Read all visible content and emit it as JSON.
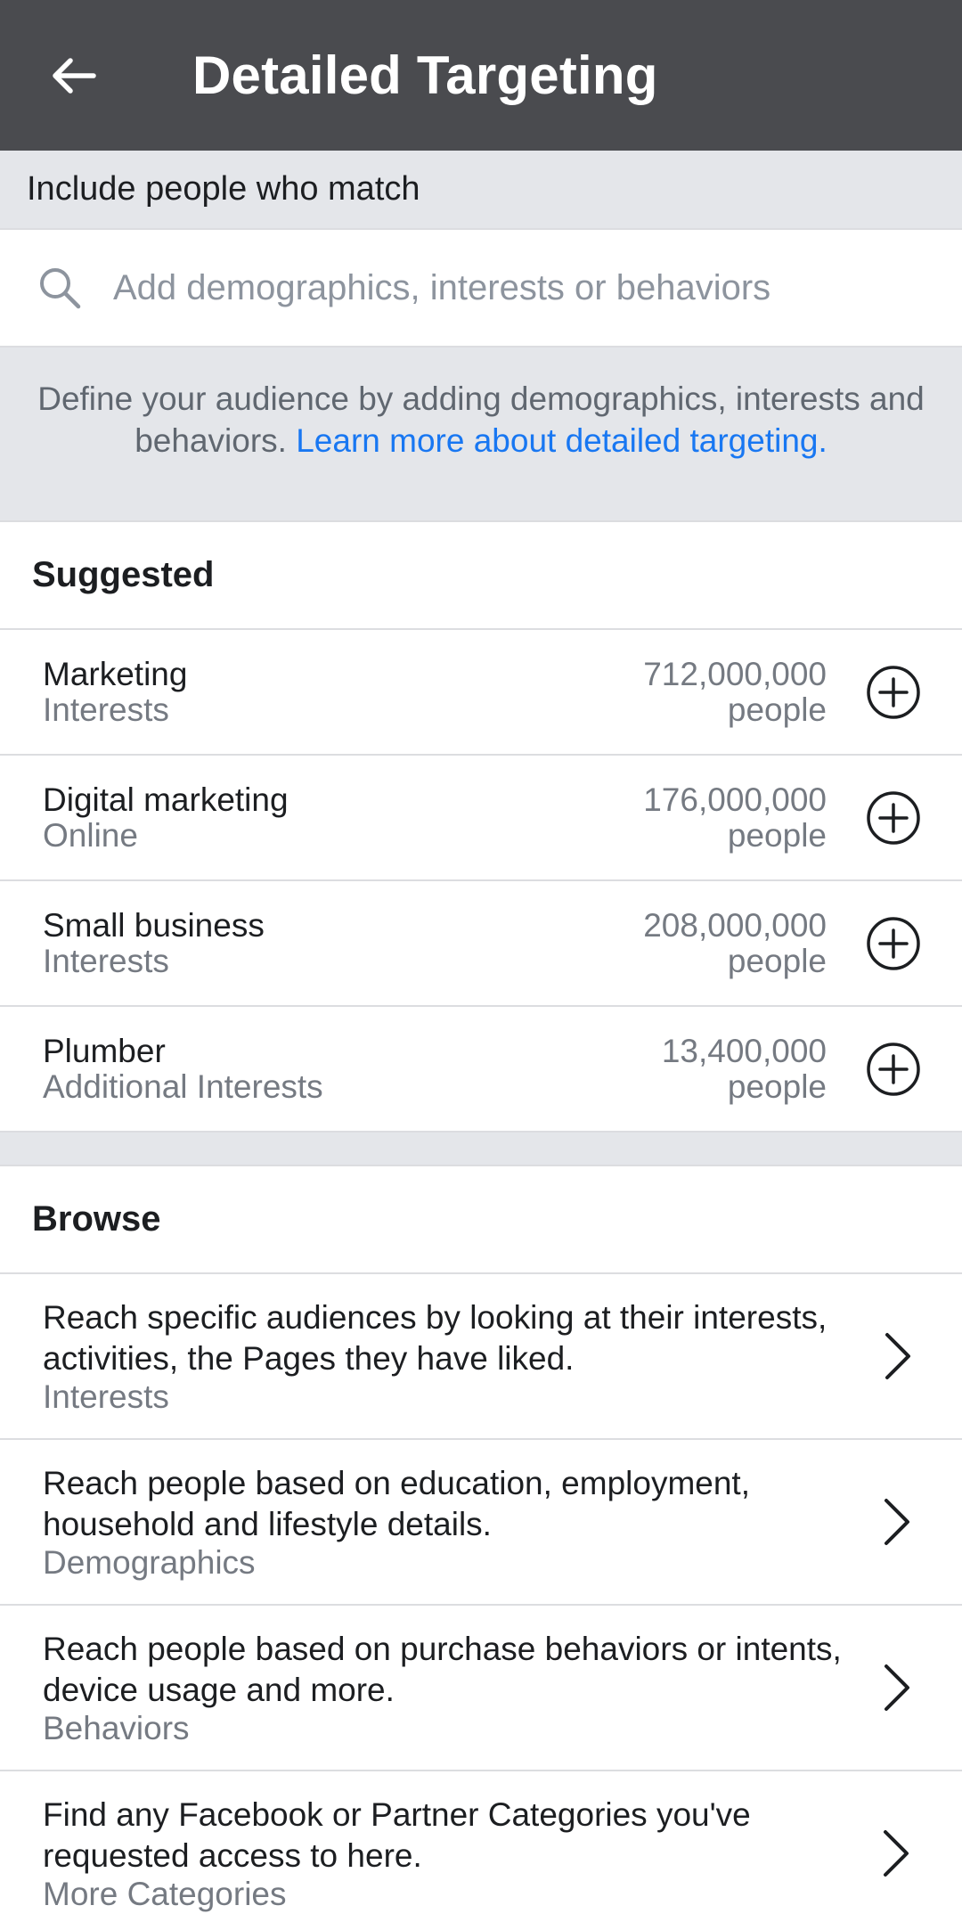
{
  "header": {
    "title": "Detailed Targeting",
    "back_icon": "arrow-left-icon"
  },
  "include_label": "Include people who match",
  "search": {
    "placeholder": "Add demographics, interests or behaviors",
    "value": "",
    "icon": "search-icon"
  },
  "info": {
    "text": "Define your audience by adding demographics, interests and behaviors. ",
    "link": "Learn more about detailed targeting."
  },
  "suggested": {
    "title": "Suggested",
    "items": [
      {
        "name": "Marketing",
        "category": "Interests",
        "count": "712,000,000",
        "unit": "people"
      },
      {
        "name": "Digital marketing",
        "category": "Online",
        "count": "176,000,000",
        "unit": "people"
      },
      {
        "name": "Small business",
        "category": "Interests",
        "count": "208,000,000",
        "unit": "people"
      },
      {
        "name": "Plumber",
        "category": "Additional Interests",
        "count": "13,400,000",
        "unit": "people"
      }
    ]
  },
  "browse": {
    "title": "Browse",
    "items": [
      {
        "desc": "Reach specific audiences by looking at their interests, activities, the Pages they have liked.",
        "category": "Interests"
      },
      {
        "desc": "Reach people based on education, employment, household and lifestyle details.",
        "category": "Demographics"
      },
      {
        "desc": "Reach people based on purchase behaviors or intents, device usage and more.",
        "category": "Behaviors"
      },
      {
        "desc": "Find any Facebook or Partner Categories you've requested access to here.",
        "category": "More Categories"
      }
    ]
  },
  "colors": {
    "topbar": "#4a4b4f",
    "band": "#e4e6ea",
    "link": "#1877f2"
  }
}
